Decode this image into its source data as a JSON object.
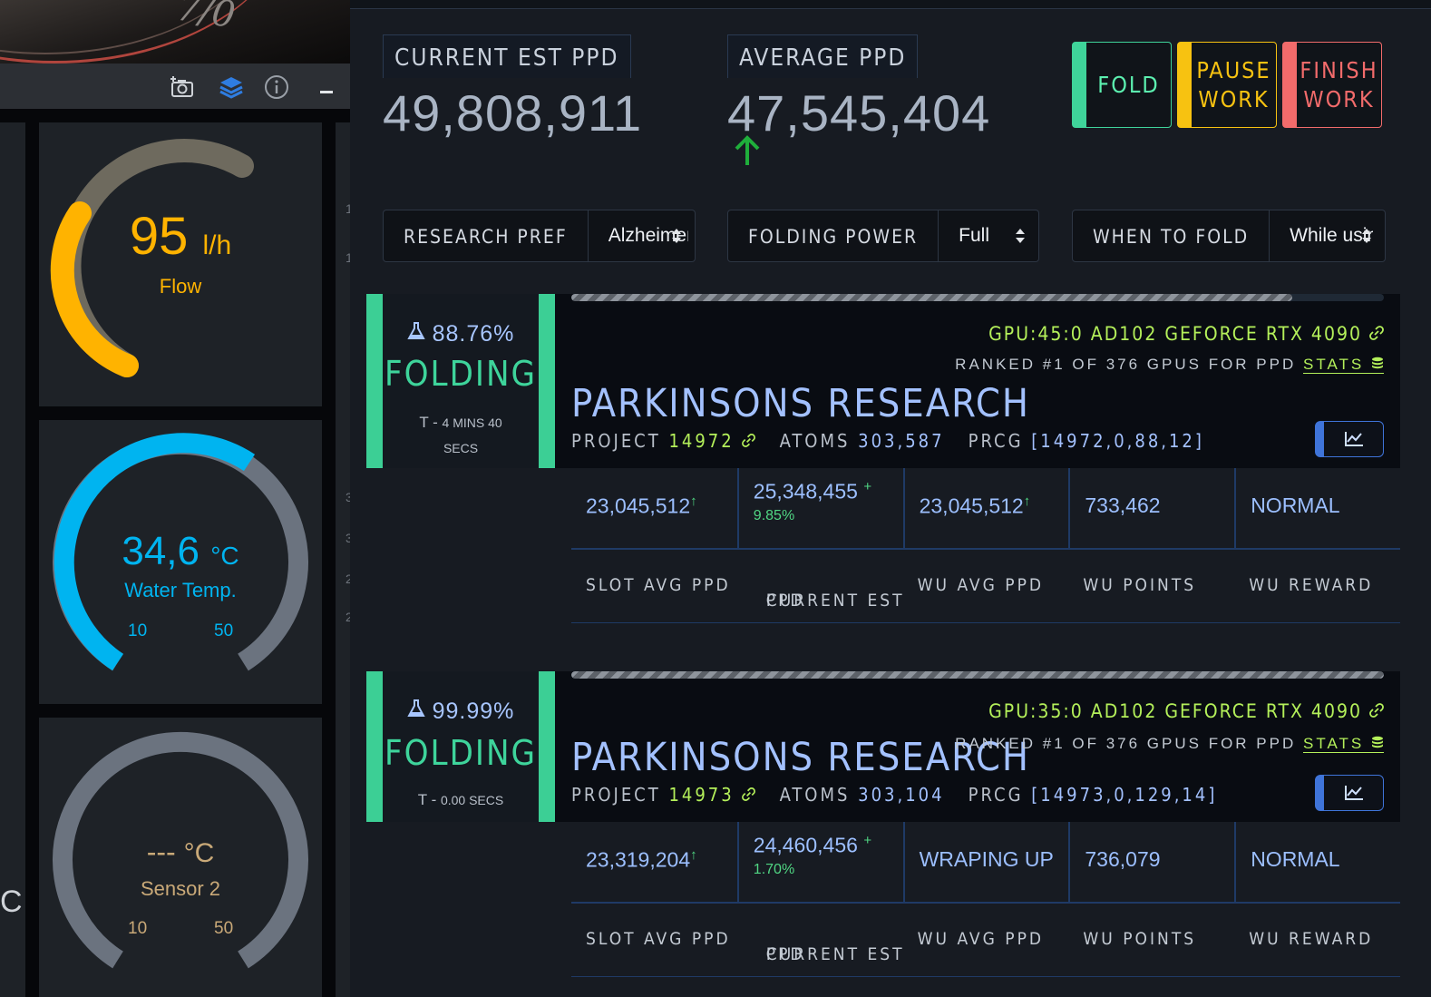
{
  "left_panel": {
    "photo_text": "7/0",
    "toolbar_icons": [
      "camera-add-icon",
      "layers-icon",
      "info-icon",
      "minimize-icon"
    ],
    "gauges": [
      {
        "name": "flow",
        "value": "95",
        "unit": "l/h",
        "label": "Flow",
        "color": "#ffb300",
        "fraction": 0.55,
        "min": "",
        "max": ""
      },
      {
        "name": "water-temp",
        "value": "34,6",
        "unit": "°C",
        "label": "Water Temp.",
        "color": "#00b4f0",
        "fraction": 0.62,
        "min": "10",
        "max": "50"
      },
      {
        "name": "sensor-2",
        "value": "---",
        "unit": "°C",
        "label": "Sensor 2",
        "color": "#c9a978",
        "fraction": 0.0,
        "min": "10",
        "max": "50"
      }
    ],
    "edge_char": "C"
  },
  "header": {
    "current_label": "CURRENT EST PPD",
    "current_value": "49,808,911",
    "average_label": "AVERAGE PPD",
    "average_value": "47,545,404"
  },
  "buttons": {
    "fold": "FOLD",
    "pause_l1": "PAUSE",
    "pause_l2": "WORK",
    "finish_l1": "FINISH",
    "finish_l2": "WORK"
  },
  "selectors": {
    "research_label": "RESEARCH PREF",
    "research_value": "Alzheimer's",
    "power_label": "FOLDING POWER",
    "power_value": "Full",
    "when_label": "WHEN TO FOLD",
    "when_value": "While using"
  },
  "slots": [
    {
      "percent": "88.76%",
      "status": "FOLDING",
      "time_prefix": "T - ",
      "time_main": "4 MINS 40",
      "time_secs": "SECS",
      "progress": 0.8876,
      "gpu": "GPU:45:0 AD102 GEFORCE RTX 4090",
      "ranked": "RANKED #1 OF 376 GPUS FOR PPD",
      "stats": "STATS",
      "research": "PARKINSONS RESEARCH",
      "project_label": "PROJECT",
      "project": "14972",
      "atoms_label": "ATOMS",
      "atoms": "303,587",
      "prcg_label": "PRCG",
      "prcg": "[14972,0,88,12]",
      "slot_avg_ppd": "23,045,512",
      "current_est_ppd": "25,348,455",
      "current_pct": "9.85%",
      "wu_avg_ppd": "23,045,512",
      "wu_points": "733,462",
      "wu_reward": "NORMAL"
    },
    {
      "percent": "99.99%",
      "status": "FOLDING",
      "time_prefix": "T - ",
      "time_main": "0.00 SECS",
      "time_secs": "",
      "progress": 0.9999,
      "gpu": "GPU:35:0 AD102 GEFORCE RTX 4090",
      "ranked": "RANKED #1 OF 376 GPUS FOR PPD",
      "stats": "STATS",
      "research": "PARKINSONS RESEARCH",
      "project_label": "PROJECT",
      "project": "14973",
      "atoms_label": "ATOMS",
      "atoms": "303,104",
      "prcg_label": "PRCG",
      "prcg": "[14973,0,129,14]",
      "slot_avg_ppd": "23,319,204",
      "current_est_ppd": "24,460,456",
      "current_pct": "1.70%",
      "wu_avg_ppd": "WRAPING UP",
      "wu_points": "736,079",
      "wu_reward": "NORMAL"
    }
  ],
  "stat_labels": {
    "slot_avg": "SLOT AVG PPD",
    "current_l1": "CURRENT EST",
    "current_l2": "PPD",
    "wu_avg": "WU AVG PPD",
    "wu_points": "WU POINTS",
    "wu_reward": "WU REWARD"
  },
  "plus_sign": "+",
  "up_sign": "↑",
  "colors": {
    "accent_green": "#3ccf95",
    "lime": "#b4f05a",
    "blue_text": "#a3c1ff",
    "pause": "#f7c211",
    "finish": "#f26b6b"
  }
}
